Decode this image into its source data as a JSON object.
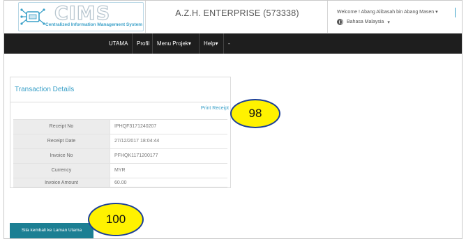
{
  "header": {
    "logo_text": "CIMS",
    "logo_subtitle": "Centralized Information Management System",
    "company": "A.Z.H. ENTERPRISE (573338)",
    "welcome": "Welcome ! Abang Alibasah bin Abang Masen",
    "language": "Bahasa Malaysia"
  },
  "nav": {
    "items": [
      "UTAMA",
      "Profil",
      "Menu Projek",
      "Help",
      "-"
    ]
  },
  "panel": {
    "title": "Transaction Details",
    "print_link": "Print Receipt",
    "rows": [
      {
        "label": "Receipt No",
        "value": "IPHQF3171240207"
      },
      {
        "label": "Receipt Date",
        "value": "27/12/2017 18:04:44"
      },
      {
        "label": "Invoice No",
        "value": "PFHQK1171200177"
      },
      {
        "label": "Currency",
        "value": "MYR"
      },
      {
        "label": "Invoice Amount",
        "value": "60.00"
      }
    ]
  },
  "back_button": "Sila kembali ke Laman Utama",
  "callouts": {
    "print": "98",
    "back": "100"
  },
  "colors": {
    "accent": "#3aa0c8",
    "nav_bg": "#1e1e1e",
    "button": "#1c7f93",
    "callout_fill": "#fff200",
    "callout_border": "#1b3f97"
  }
}
